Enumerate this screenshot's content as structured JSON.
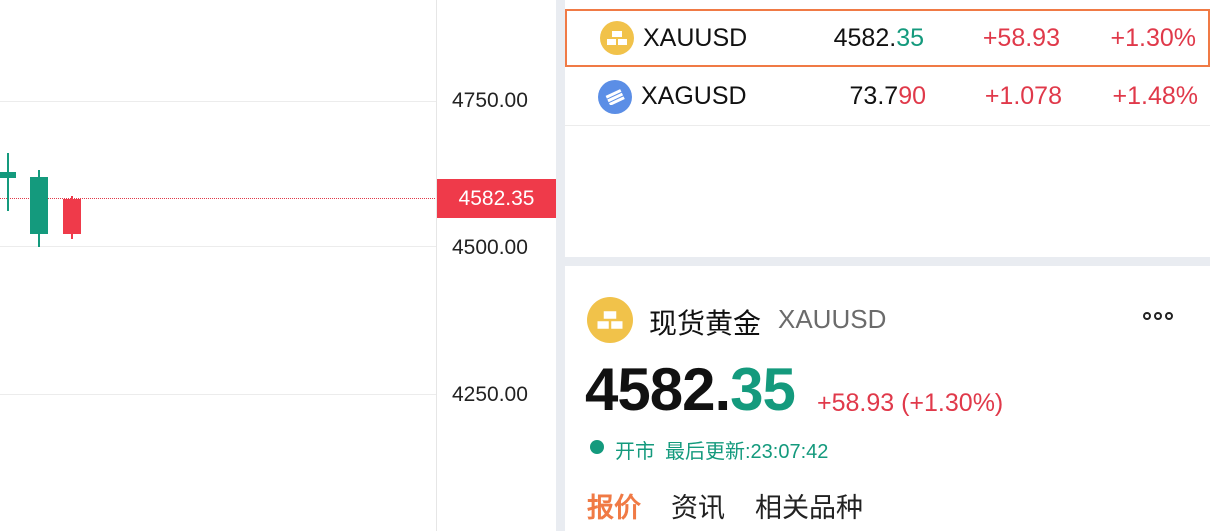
{
  "chart": {
    "y_ticks": [
      "4750.00",
      "4500.00",
      "4250.00"
    ],
    "last_price": "4582.35"
  },
  "watchlist": [
    {
      "symbol": "XAUUSD",
      "price_main": "4582.",
      "price_tail": "35",
      "change": "+58.93",
      "change_pct": "+1.30%",
      "icon": "gold-bar-icon",
      "selected": true
    },
    {
      "symbol": "XAGUSD",
      "price_main": "73.7",
      "price_tail": "90",
      "change": "+1.078",
      "change_pct": "+1.48%",
      "icon": "silver-bar-icon",
      "selected": false
    }
  ],
  "detail": {
    "name": "现货黄金",
    "symbol": "XAUUSD",
    "price_main": "4582.",
    "price_tail": "35",
    "change_text": "+58.93 (+1.30%)",
    "status": "开市",
    "last_update": "最后更新:23:07:42",
    "more_icon": "more-dots-icon"
  },
  "tabs": [
    "报价",
    "资讯",
    "相关品种"
  ],
  "colors": {
    "up": "#e0394a",
    "down": "#149a7d",
    "accent": "#f07a45",
    "gold": "#f1c24a",
    "silver": "#5b8ee6"
  }
}
